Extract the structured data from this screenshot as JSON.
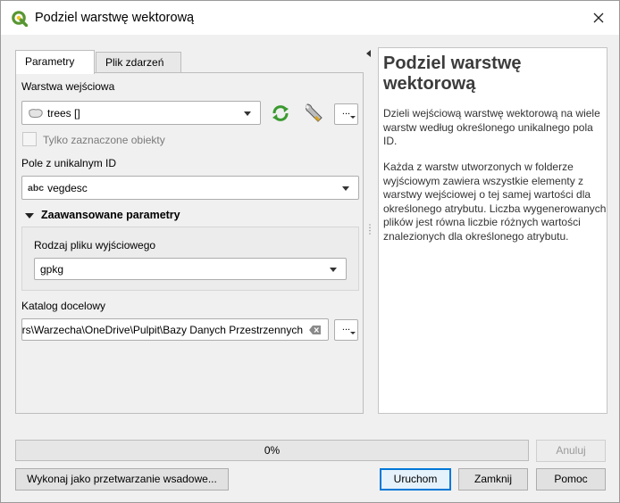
{
  "window": {
    "title": "Podziel warstwę wektorową"
  },
  "tabs": [
    {
      "label": "Parametry",
      "active": true
    },
    {
      "label": "Plik zdarzeń",
      "active": false
    }
  ],
  "params": {
    "input_layer": {
      "label": "Warstwa wejściowa",
      "value": "trees []"
    },
    "selected_only": {
      "label": "Tylko zaznaczone obiekty",
      "checked": false
    },
    "unique_field": {
      "label": "Pole z unikalnym ID",
      "type_badge": "abc",
      "value": "vegdesc"
    },
    "advanced": {
      "header": "Zaawansowane parametry",
      "file_type": {
        "label": "Rodzaj pliku wyjściowego",
        "value": "gpkg"
      }
    },
    "output_dir": {
      "label": "Katalog docelowy",
      "value": "C:\\Users\\Warzecha\\OneDrive\\Pulpit\\Bazy Danych Przestrzennych"
    },
    "browse_label": "..."
  },
  "help": {
    "title": "Podziel warstwę wektorową",
    "p1": "Dzieli wejściową warstwę wektorową na wiele warstw według określonego unikalnego pola ID.",
    "p2": "Każda z warstw utworzonych w folderze wyjściowym zawiera wszystkie elementy z warstwy wejściowej o tej samej wartości dla określonego atrybutu. Liczba wygenerowanych plików jest równa liczbie różnych wartości znalezionych dla określonego atrybutu."
  },
  "progress": {
    "percent": 0,
    "text": "0%"
  },
  "buttons": {
    "cancel": "Anuluj",
    "batch": "Wykonaj jako przetwarzanie wsadowe...",
    "run": "Uruchom",
    "close": "Zamknij",
    "help": "Pomoc"
  },
  "colors": {
    "accent": "#0078d7",
    "qgis_green": "#589632",
    "qgis_yellow": "#f0c419"
  }
}
